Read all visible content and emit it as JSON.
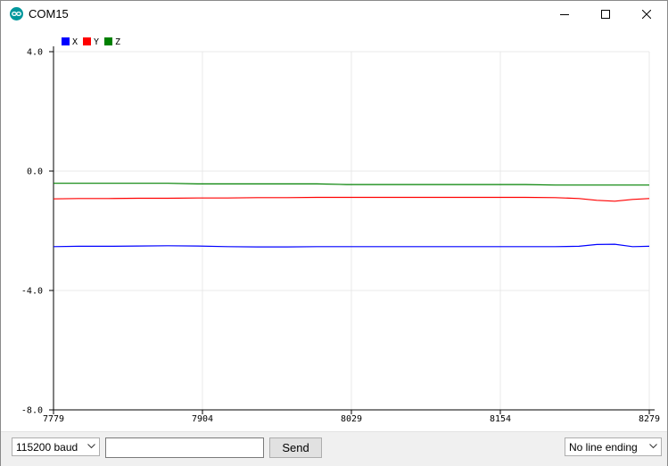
{
  "window": {
    "title": "COM15",
    "accent": "#00979c"
  },
  "controls": {
    "minimize": "minimize",
    "maximize": "maximize",
    "close": "close"
  },
  "statusbar": {
    "baud": "115200 baud",
    "send_placeholder": "",
    "send_label": "Send",
    "line_ending": "No line ending"
  },
  "chart_data": {
    "type": "line",
    "title": "",
    "xlabel": "",
    "ylabel": "",
    "xlim": [
      7779,
      8279
    ],
    "ylim": [
      -8.0,
      4.0
    ],
    "x_ticks": [
      "7779",
      "7904",
      "8029",
      "8154",
      "8279"
    ],
    "y_ticks": [
      "4.0",
      "0.0",
      "-4.0",
      "-8.0"
    ],
    "y_tick_values": [
      4.0,
      0.0,
      -4.0,
      -8.0
    ],
    "grid": true,
    "legend_position": "top-left",
    "series": [
      {
        "name": "X",
        "color": "#0000ff",
        "x": [
          7779,
          7800,
          7825,
          7850,
          7875,
          7900,
          7925,
          7950,
          7975,
          8000,
          8025,
          8050,
          8075,
          8100,
          8125,
          8150,
          8175,
          8200,
          8220,
          8235,
          8250,
          8265,
          8279
        ],
        "y": [
          -2.53,
          -2.52,
          -2.52,
          -2.51,
          -2.5,
          -2.51,
          -2.53,
          -2.54,
          -2.54,
          -2.53,
          -2.53,
          -2.53,
          -2.53,
          -2.53,
          -2.53,
          -2.53,
          -2.53,
          -2.53,
          -2.52,
          -2.46,
          -2.45,
          -2.53,
          -2.52
        ]
      },
      {
        "name": "Y",
        "color": "#ff0000",
        "x": [
          7779,
          7800,
          7825,
          7850,
          7875,
          7900,
          7925,
          7950,
          7975,
          8000,
          8025,
          8050,
          8075,
          8100,
          8125,
          8150,
          8175,
          8200,
          8220,
          8235,
          8250,
          8265,
          8279
        ],
        "y": [
          -0.93,
          -0.92,
          -0.92,
          -0.91,
          -0.91,
          -0.9,
          -0.9,
          -0.89,
          -0.89,
          -0.88,
          -0.88,
          -0.88,
          -0.88,
          -0.88,
          -0.88,
          -0.88,
          -0.88,
          -0.89,
          -0.92,
          -0.98,
          -1.01,
          -0.95,
          -0.92
        ]
      },
      {
        "name": "Z",
        "color": "#008000",
        "x": [
          7779,
          7800,
          7825,
          7850,
          7875,
          7900,
          7925,
          7950,
          7975,
          8000,
          8025,
          8050,
          8075,
          8100,
          8125,
          8150,
          8175,
          8200,
          8220,
          8235,
          8250,
          8265,
          8279
        ],
        "y": [
          -0.41,
          -0.41,
          -0.41,
          -0.41,
          -0.41,
          -0.43,
          -0.43,
          -0.43,
          -0.43,
          -0.43,
          -0.45,
          -0.45,
          -0.45,
          -0.45,
          -0.45,
          -0.45,
          -0.45,
          -0.47,
          -0.47,
          -0.47,
          -0.47,
          -0.47,
          -0.47
        ]
      }
    ]
  }
}
